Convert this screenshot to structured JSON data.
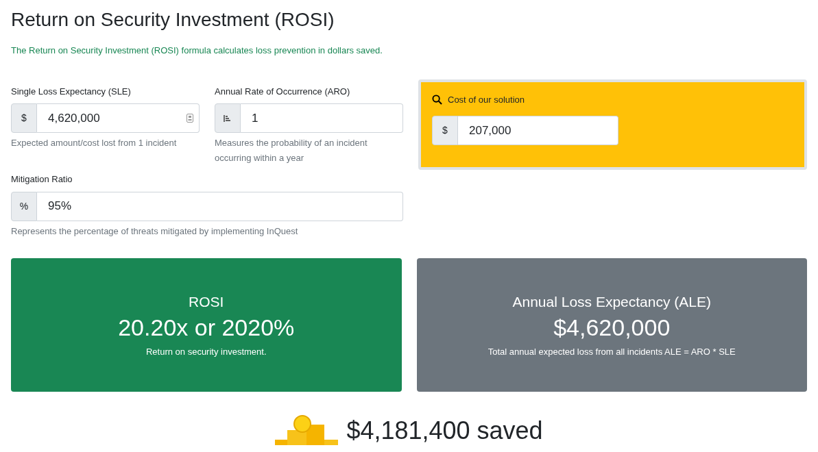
{
  "title": "Return on Security Investment (ROSI)",
  "subtitle": "The Return on Security Investment (ROSI) formula calculates loss prevention in dollars saved.",
  "fields": [
    {
      "label": "Single Loss Expectancy (SLE)",
      "addon": "$",
      "kind": "currency",
      "value": "4,620,000",
      "help": "Expected amount/cost lost from 1 incident"
    },
    {
      "label": "Annual Rate of Occurrence (ARO)",
      "kind": "rate",
      "value": "1",
      "help": "Measures the probability of an incident occurring within a year"
    },
    {
      "label": "Mitigation Ratio",
      "addon": "%",
      "kind": "percent",
      "value": "95%",
      "help": "Represents the percentage of threats mitigated by implementing InQuest"
    }
  ],
  "cost": {
    "label": "Cost of our solution",
    "addon": "$",
    "value": "207,000"
  },
  "results": [
    {
      "kind": "success",
      "title": "ROSI",
      "value": "20.20x or 2020%",
      "caption": "Return on security investment."
    },
    {
      "kind": "secondary",
      "title": "Annual Loss Expectancy (ALE)",
      "value": "$4,620,000",
      "caption": "Total annual expected loss from all incidents ALE = ARO * SLE"
    }
  ],
  "savings": "$4,181,400 saved"
}
